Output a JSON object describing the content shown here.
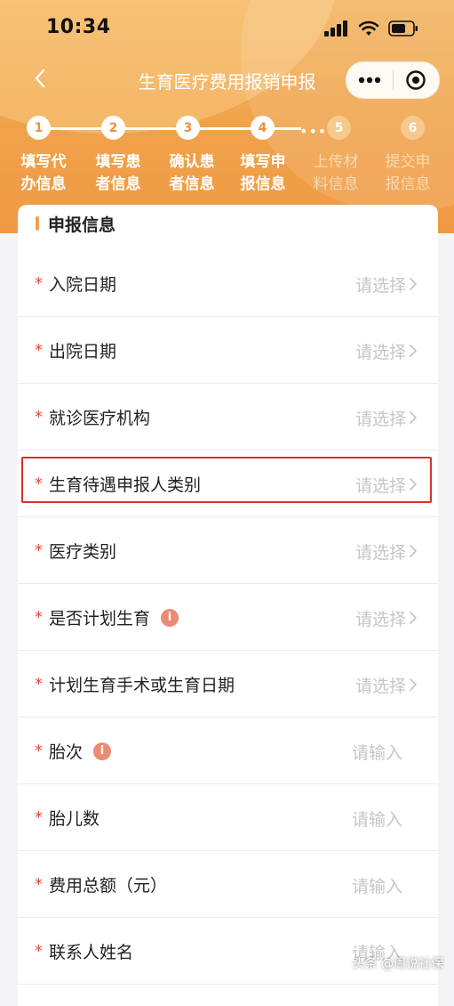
{
  "status_bar": {
    "time": "10:34"
  },
  "navbar": {
    "title": "生育医疗费用报销申报"
  },
  "steps": [
    {
      "number": "1",
      "line1": "填写代",
      "line2": "办信息",
      "active": true
    },
    {
      "number": "2",
      "line1": "填写患",
      "line2": "者信息",
      "active": true
    },
    {
      "number": "3",
      "line1": "确认患",
      "line2": "者信息",
      "active": true
    },
    {
      "number": "4",
      "line1": "填写申",
      "line2": "报信息",
      "active": true
    },
    {
      "number": "5",
      "line1": "上传材",
      "line2": "料信息",
      "active": false
    },
    {
      "number": "6",
      "line1": "提交申",
      "line2": "报信息",
      "active": false
    }
  ],
  "form": {
    "section_title": "申报信息",
    "required_mark": "*",
    "rows": [
      {
        "label": "入院日期",
        "value": "请选择",
        "type": "select"
      },
      {
        "label": "出院日期",
        "value": "请选择",
        "type": "select"
      },
      {
        "label": "就诊医疗机构",
        "value": "请选择",
        "type": "select"
      },
      {
        "label": "生育待遇申报人类别",
        "value": "请选择",
        "type": "select"
      },
      {
        "label": "医疗类别",
        "value": "请选择",
        "type": "select"
      },
      {
        "label": "是否计划生育",
        "value": "请选择",
        "type": "select",
        "info": "i"
      },
      {
        "label": "计划生育手术或生育日期",
        "value": "请选择",
        "type": "select"
      },
      {
        "label": "胎次",
        "value": "请输入",
        "type": "input",
        "info": "i"
      },
      {
        "label": "胎儿数",
        "value": "请输入",
        "type": "input"
      },
      {
        "label": "费用总额（元）",
        "value": "请输入",
        "type": "input"
      },
      {
        "label": "联系人姓名",
        "value": "请输入",
        "type": "input"
      }
    ]
  },
  "watermark": "头条 @周说社保",
  "colors": {
    "accent": "#f0a24a",
    "required": "#e14b3b",
    "highlight_border": "#d9312f",
    "placeholder": "#c6c6c6"
  }
}
